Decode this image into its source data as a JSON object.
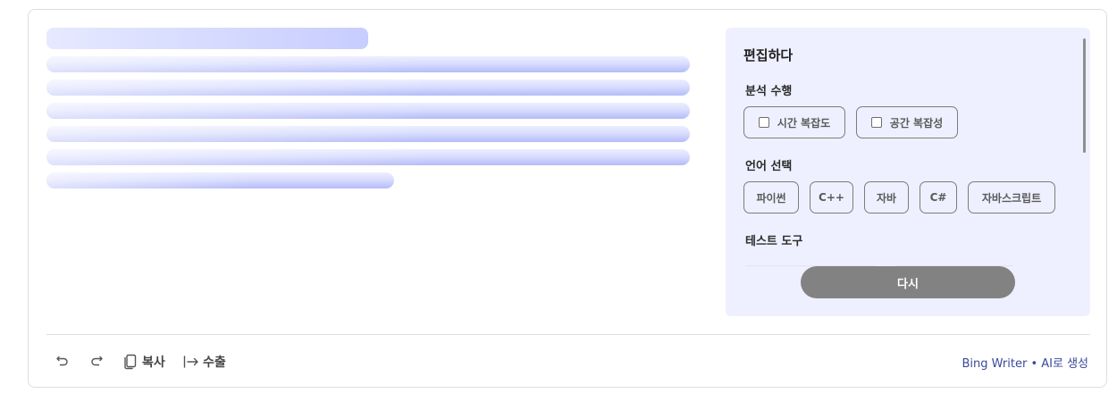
{
  "edit_panel": {
    "title": "편집하다",
    "analysis": {
      "label": "분석 수행",
      "options": [
        "시간 복잡도",
        "공간 복잡성"
      ]
    },
    "language": {
      "label": "언어 선택",
      "options": [
        "파이썬",
        "C++",
        "자바",
        "C#",
        "자바스크립트"
      ]
    },
    "test_tools": {
      "label": "테스트 도구"
    },
    "retry_label": "다시"
  },
  "toolbar": {
    "copy_label": "복사",
    "export_label": "수출"
  },
  "footer": {
    "brand": "Bing Writer • AI로 생성"
  },
  "colors": {
    "panel_bg": "#eff0ff",
    "skeleton": "#c7cdff",
    "retry_bg": "#828282",
    "brand_link": "#3a4a9a"
  }
}
